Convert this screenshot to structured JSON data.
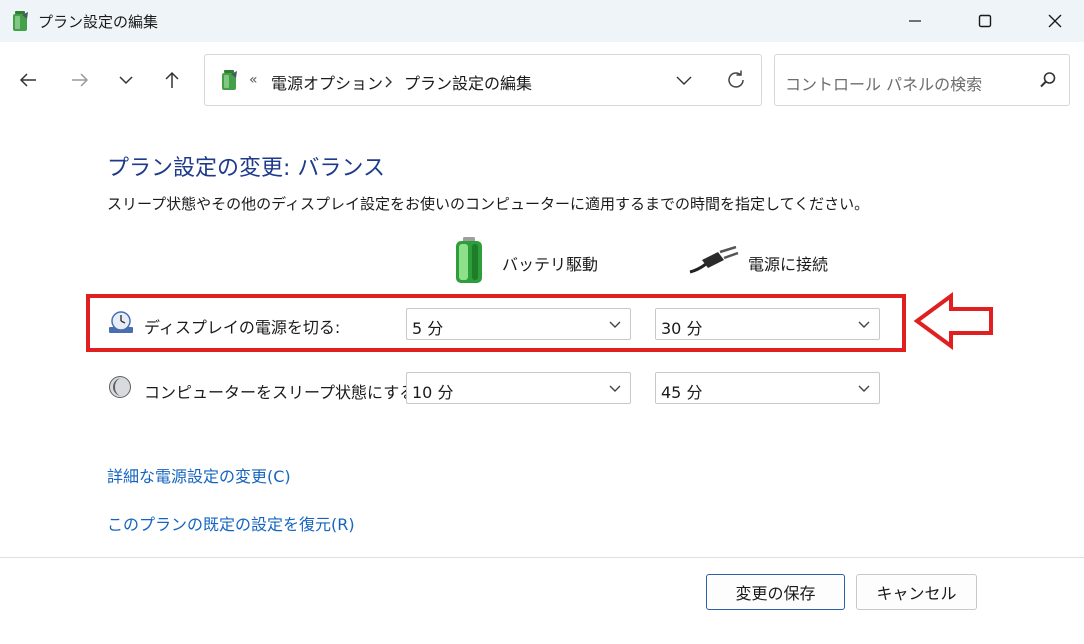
{
  "window": {
    "title": "プラン設定の編集",
    "icon": "power-battery-icon"
  },
  "address_bar": {
    "overflow": "«",
    "crumbs": [
      "電源オプション",
      "プラン設定の編集"
    ],
    "search_placeholder": "コントロール パネルの検索"
  },
  "main": {
    "heading": "プラン設定の変更: バランス",
    "description": "スリープ状態やその他のディスプレイ設定をお使いのコンピューターに適用するまでの時間を指定してください。",
    "columns": {
      "battery": "バッテリ駆動",
      "plugged": "電源に接続"
    },
    "settings": [
      {
        "label": "ディスプレイの電源を切る:",
        "battery": "5 分",
        "plugged": "30 分"
      },
      {
        "label": "コンピューターをスリープ状態にする:",
        "battery": "10 分",
        "plugged": "45 分"
      }
    ],
    "links": {
      "advanced": "詳細な電源設定の変更(C)",
      "restore": "このプランの既定の設定を復元(R)"
    }
  },
  "footer": {
    "save": "変更の保存",
    "cancel": "キャンセル"
  },
  "colors": {
    "heading": "#1e3a8a",
    "link": "#1565c0",
    "highlight": "#e02020"
  }
}
